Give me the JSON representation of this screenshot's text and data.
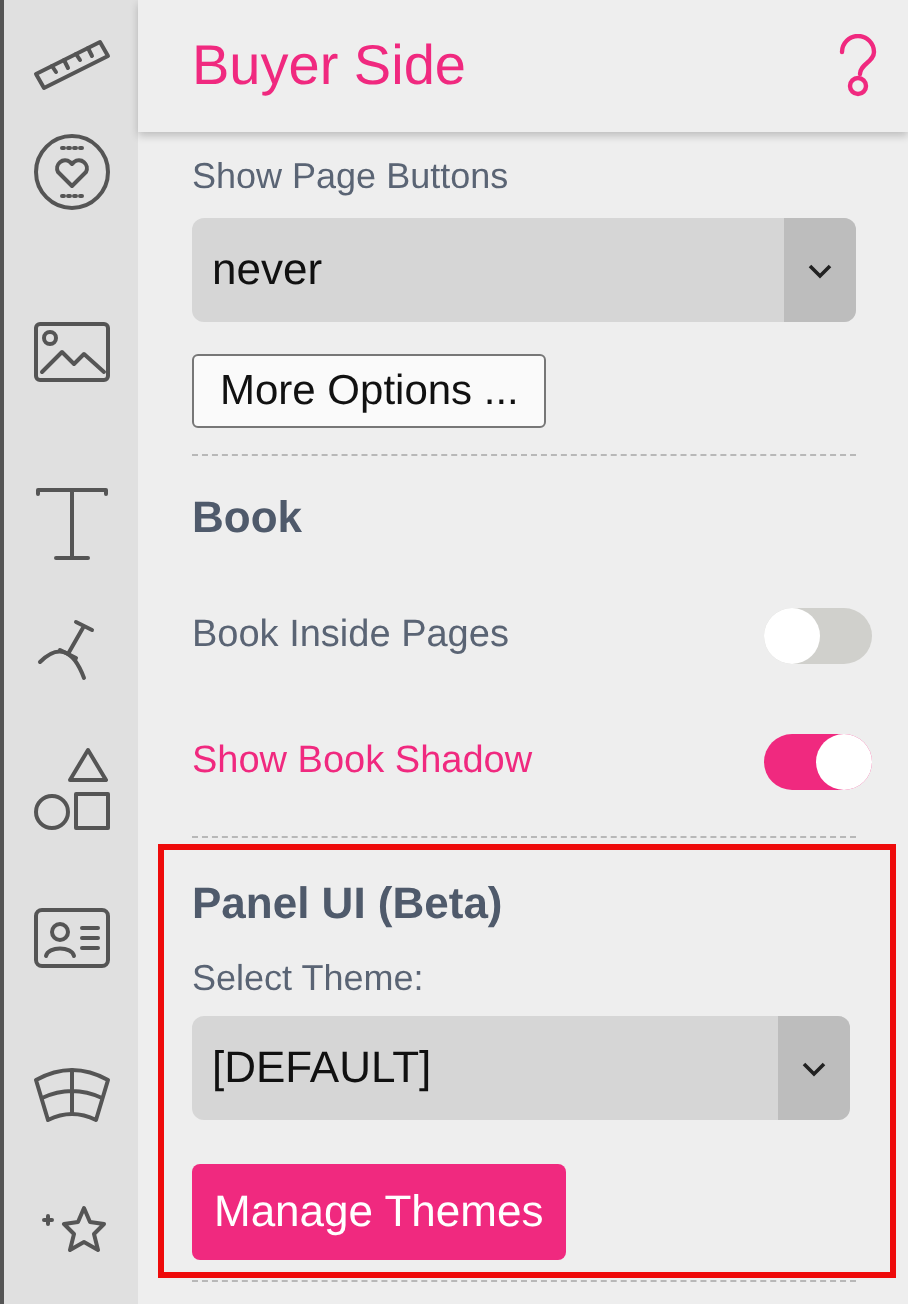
{
  "panel": {
    "title": "Buyer Side"
  },
  "page_buttons": {
    "label": "Show Page Buttons",
    "value": "never",
    "more_button": "More Options ..."
  },
  "book": {
    "heading": "Book",
    "toggles": [
      {
        "label": "Book Inside Pages",
        "on": false
      },
      {
        "label": "Show Book Shadow",
        "on": true
      }
    ]
  },
  "panel_ui": {
    "heading": "Panel UI (Beta)",
    "highlighted": true,
    "theme_label": "Select Theme:",
    "theme_value": "[DEFAULT]",
    "manage_button": "Manage Themes"
  }
}
